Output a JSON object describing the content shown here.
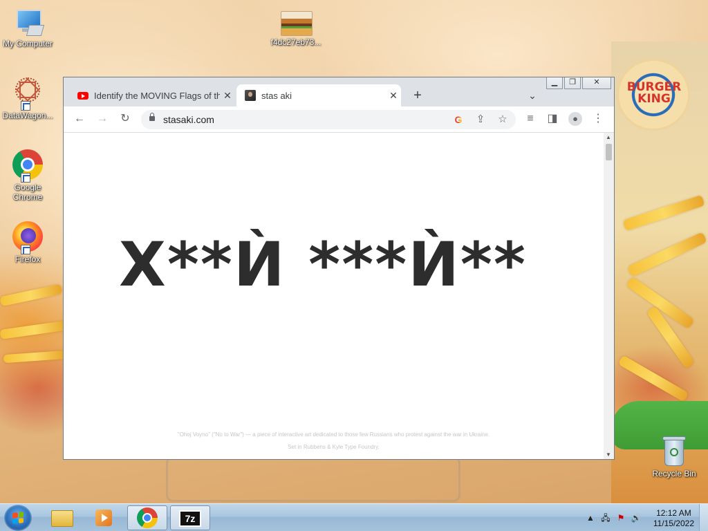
{
  "desktop": {
    "icons": [
      {
        "label": "My Computer"
      },
      {
        "label": "f4dc27eb73..."
      },
      {
        "label": "DataWagon..."
      },
      {
        "label": "Google Chrome"
      },
      {
        "label": "Firefox"
      },
      {
        "label": "Recycle Bin"
      }
    ],
    "wallpaper_logo_text": "BURGER KING"
  },
  "browser": {
    "tabs": [
      {
        "title": "Identify the MOVING Flags of the",
        "icon": "youtube-icon",
        "active": false
      },
      {
        "title": "stas aki",
        "icon": "site-favicon",
        "active": true
      }
    ],
    "new_tab_label": "+",
    "url": "stasaki.com",
    "page": {
      "headline": "Х**Ѝ  ***Ѝ**",
      "footer_line1": "\"Ohoj Voyno\" (\"No to War\") — a piece of interactive art dedicated to those few Russians who protest against the war in Ukraine.",
      "footer_line2": "Set in Rubbens & Kyle Type Foundry."
    }
  },
  "taskbar": {
    "pinned": [
      "start-button",
      "explorer",
      "media-player",
      "chrome",
      "7zip"
    ],
    "time": "12:12 AM",
    "date": "11/15/2022"
  },
  "colors": {
    "taskbar": "#a9c6df",
    "tab_strip": "#dee1e6",
    "headline": "#2d2d2d"
  }
}
